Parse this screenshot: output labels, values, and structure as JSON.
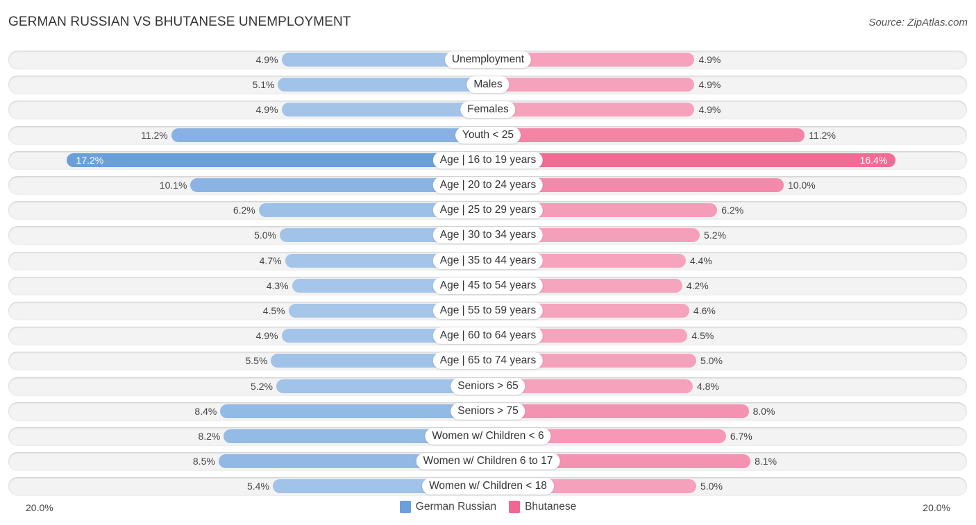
{
  "header": {
    "title": "GERMAN RUSSIAN VS BHUTANESE UNEMPLOYMENT",
    "source": "Source: ZipAtlas.com"
  },
  "colors": {
    "german_russian": "#6a9fdc",
    "german_russian_light": "#a7c6ea",
    "bhutanese": "#f06892",
    "bhutanese_light": "#f6a6bf"
  },
  "chart_data": {
    "type": "bar",
    "orientation": "horizontal-diverging",
    "title": "GERMAN RUSSIAN VS BHUTANESE UNEMPLOYMENT",
    "xlabel": "",
    "ylabel": "",
    "xlim": [
      0,
      20.0
    ],
    "axis_labels": {
      "left": "20.0%",
      "right": "20.0%"
    },
    "legend": {
      "position": "bottom-center",
      "entries": [
        "German Russian",
        "Bhutanese"
      ]
    },
    "unit": "%",
    "categories": [
      "Unemployment",
      "Males",
      "Females",
      "Youth < 25",
      "Age | 16 to 19 years",
      "Age | 20 to 24 years",
      "Age | 25 to 29 years",
      "Age | 30 to 34 years",
      "Age | 35 to 44 years",
      "Age | 45 to 54 years",
      "Age | 55 to 59 years",
      "Age | 60 to 64 years",
      "Age | 65 to 74 years",
      "Seniors > 65",
      "Seniors > 75",
      "Women w/ Children < 6",
      "Women w/ Children 6 to 17",
      "Women w/ Children < 18"
    ],
    "series": [
      {
        "name": "German Russian",
        "side": "left",
        "values": [
          4.9,
          5.1,
          4.9,
          11.2,
          17.2,
          10.1,
          6.2,
          5.0,
          4.7,
          4.3,
          4.5,
          4.9,
          5.5,
          5.2,
          8.4,
          8.2,
          8.5,
          5.4
        ],
        "labels": [
          "4.9%",
          "5.1%",
          "4.9%",
          "11.2%",
          "17.2%",
          "10.1%",
          "6.2%",
          "5.0%",
          "4.7%",
          "4.3%",
          "4.5%",
          "4.9%",
          "5.5%",
          "5.2%",
          "8.4%",
          "8.2%",
          "8.5%",
          "5.4%"
        ]
      },
      {
        "name": "Bhutanese",
        "side": "right",
        "values": [
          4.9,
          4.9,
          4.9,
          11.2,
          16.4,
          10.0,
          6.2,
          5.2,
          4.4,
          4.2,
          4.6,
          4.5,
          5.0,
          4.8,
          8.0,
          6.7,
          8.1,
          5.0
        ],
        "labels": [
          "4.9%",
          "4.9%",
          "4.9%",
          "11.2%",
          "16.4%",
          "10.0%",
          "6.2%",
          "5.2%",
          "4.4%",
          "4.2%",
          "4.6%",
          "4.5%",
          "5.0%",
          "4.8%",
          "8.0%",
          "6.7%",
          "8.1%",
          "5.0%"
        ]
      }
    ]
  }
}
